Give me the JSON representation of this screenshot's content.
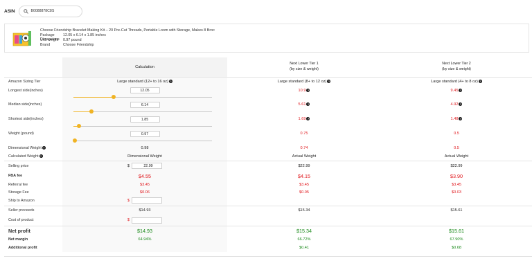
{
  "asin": {
    "label": "ASIN",
    "value": "B0088878C8S"
  },
  "product": {
    "title": "Choose Friendship Bracelet Making Kit – 20 Pre-Cut Threads, Portable Loom with Storage, Makes 8 Broc",
    "info": [
      {
        "key": "Package Dimensions",
        "value": "12.05 x 6.14 x 1.85 inches"
      },
      {
        "key": "Unit weight",
        "value": "0.97 pound"
      },
      {
        "key": "Brand",
        "value": "Choose Friendship"
      }
    ]
  },
  "headers": {
    "calc": "Calculation",
    "tier1_line1": "Next Lower Tier 1",
    "tier1_line2": "(by size & weight)",
    "tier2_line1": "Next Lower Tier 2",
    "tier2_line2": "(by size & weight)"
  },
  "rows": {
    "sizing_tier": {
      "label": "Amazon Sizing Tier",
      "calc": "Large standard (12+ to 16 oz)",
      "t1": "Large standard (8+ to 12 oz)",
      "t2": "Large standard (4+ to 8 oz)"
    },
    "longest": {
      "label": "Longest side(inches)",
      "calc": "12.05",
      "t1": "10.9",
      "t2": "9.45",
      "slider_fraction": 0.29
    },
    "median": {
      "label": "Median side(inches)",
      "calc": "6.14",
      "t1": "5.61",
      "t2": "4.92",
      "slider_fraction": 0.13
    },
    "shortest": {
      "label": "Shortest side(inches)",
      "calc": "1.85",
      "t1": "1.69",
      "t2": "1.48",
      "slider_fraction": 0.04
    },
    "weight": {
      "label": "Weight (pound)",
      "calc": "0.97",
      "t1": "0.75",
      "t2": "0.5",
      "slider_fraction": 0.01
    },
    "dim_weight": {
      "label": "Dimensional Weight",
      "calc": "0.98",
      "t1": "0.74",
      "t2": "0.5"
    },
    "calc_weight": {
      "label": "Calculated Weight",
      "calc": "Dimensional Weight",
      "t1": "Actual Weight",
      "t2": "Actual Weight"
    },
    "selling_price": {
      "label": "Selling price",
      "currency": "$",
      "calc": "22.99",
      "t1": "$22.99",
      "t2": "$22.99"
    },
    "fba_fee": {
      "label": "FBA fee",
      "calc": "$4.55",
      "t1": "$4.15",
      "t2": "$3.90"
    },
    "referral_fee": {
      "label": "Referral fee",
      "calc": "$3.45",
      "t1": "$3.45",
      "t2": "$3.45"
    },
    "storage_fee": {
      "label": "Storage Fee",
      "calc": "$0.06",
      "t1": "$0.05",
      "t2": "$0.03"
    },
    "ship_to_amazon": {
      "label": "Ship to Amazon",
      "currency": "$",
      "calc": ""
    },
    "seller_proceeds": {
      "label": "Seller proceeds",
      "calc": "$14.93",
      "t1": "$15.34",
      "t2": "$15.61"
    },
    "cost_of_product": {
      "label": "Cost of product",
      "currency": "$",
      "calc": ""
    },
    "net_profit": {
      "label": "Net profit",
      "calc": "$14.93",
      "t1": "$15.34",
      "t2": "$15.61"
    },
    "net_margin": {
      "label": "Net margin",
      "calc": "64.94%",
      "t1": "66.72%",
      "t2": "67.90%"
    },
    "additional_profit": {
      "label": "Additional profit",
      "calc": "",
      "t1": "$0.41",
      "t2": "$0.68"
    }
  },
  "colors": {
    "accent": "#f0b323",
    "negative": "#e0161b",
    "positive": "#1b8a1b"
  }
}
